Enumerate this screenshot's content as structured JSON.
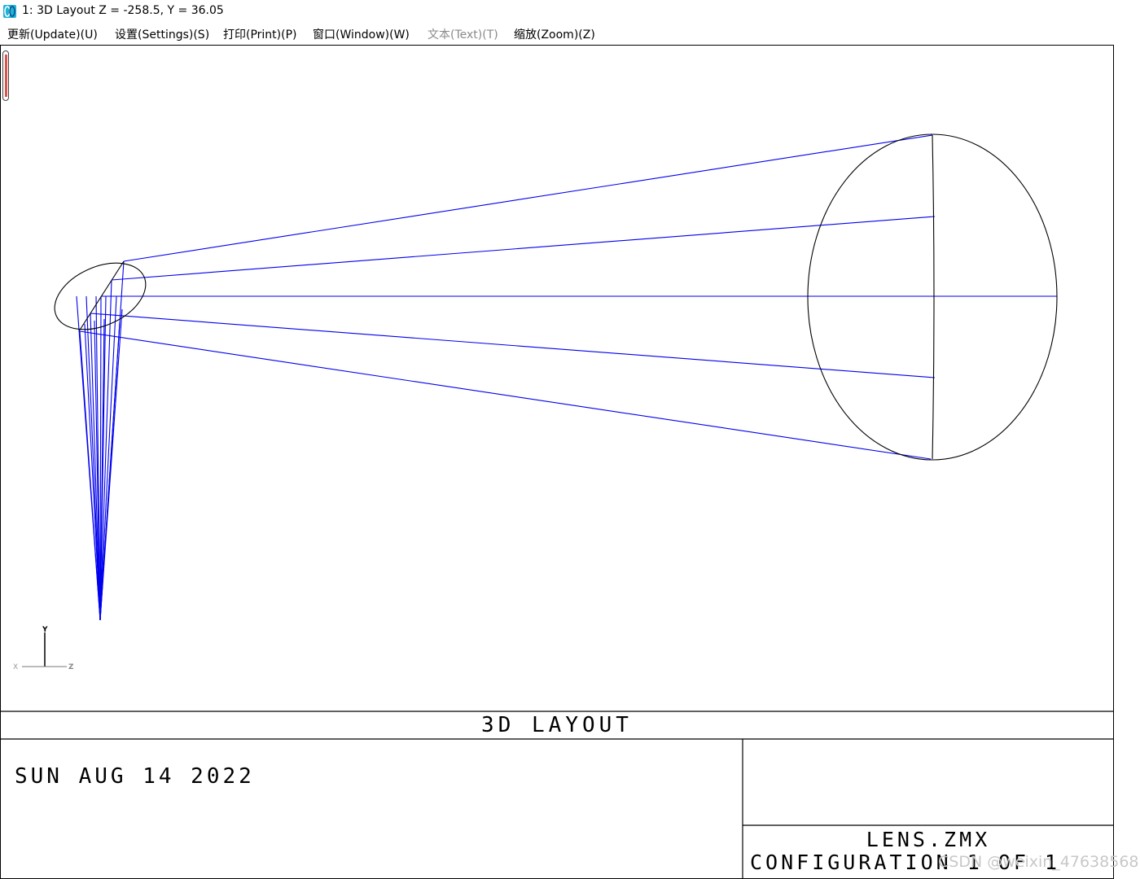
{
  "window": {
    "title": "1: 3D Layout Z = -258.5, Y = 36.05",
    "icon": "zemax-app-icon"
  },
  "menu": {
    "items": [
      {
        "label": "更新(Update)(U)",
        "enabled": true
      },
      {
        "label": "设置(Settings)(S)",
        "enabled": true
      },
      {
        "label": "打印(Print)(P)",
        "enabled": true
      },
      {
        "label": "窗口(Window)(W)",
        "enabled": true
      },
      {
        "label": "文本(Text)(T)",
        "enabled": false
      },
      {
        "label": "缩放(Zoom)(Z)",
        "enabled": true
      }
    ]
  },
  "plot": {
    "title": "3D LAYOUT",
    "date": "SUN AUG 14 2022",
    "lens_file": "LENS.ZMX",
    "configuration": "CONFIGURATION 1 OF 1",
    "axis_labels": {
      "y": "Y",
      "x": "X",
      "z": "Z"
    },
    "colors": {
      "rays": "#0000ee",
      "surfaces": "#000000"
    }
  },
  "watermark": "CSDN @weixin_47638568"
}
